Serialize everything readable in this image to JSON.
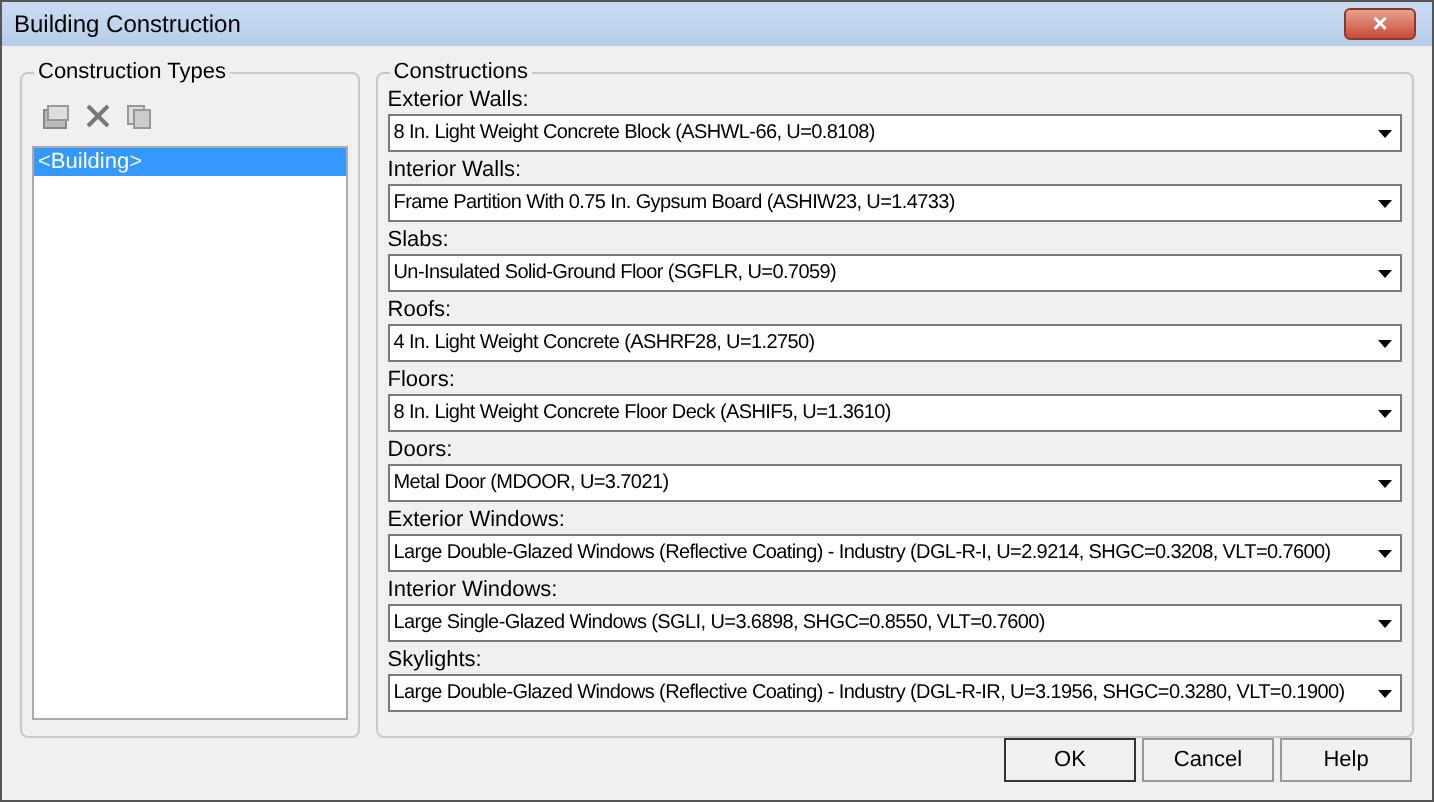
{
  "window": {
    "title": "Building Construction",
    "close": "×"
  },
  "construction_types": {
    "title": "Construction Types",
    "items": [
      {
        "label": "<Building>",
        "selected": true
      }
    ]
  },
  "constructions": {
    "title": "Constructions",
    "fields": [
      {
        "label": "Exterior Walls:",
        "value": "8 In. Light Weight Concrete Block (ASHWL-66, U=0.8108)"
      },
      {
        "label": "Interior Walls:",
        "value": "Frame Partition With 0.75 In. Gypsum Board (ASHIW23, U=1.4733)"
      },
      {
        "label": "Slabs:",
        "value": "Un-Insulated Solid-Ground Floor (SGFLR, U=0.7059)"
      },
      {
        "label": "Roofs:",
        "value": "4 In. Light Weight Concrete (ASHRF28, U=1.2750)"
      },
      {
        "label": "Floors:",
        "value": "8 In. Light Weight Concrete Floor Deck (ASHIF5, U=1.3610)"
      },
      {
        "label": "Doors:",
        "value": "Metal Door (MDOOR, U=3.7021)"
      },
      {
        "label": "Exterior Windows:",
        "value": "Large Double-Glazed Windows (Reflective Coating) - Industry (DGL-R-I, U=2.9214, SHGC=0.3208, VLT=0.7600)"
      },
      {
        "label": "Interior Windows:",
        "value": "Large Single-Glazed Windows (SGLI, U=3.6898, SHGC=0.8550, VLT=0.7600)"
      },
      {
        "label": "Skylights:",
        "value": "Large Double-Glazed Windows (Reflective Coating) - Industry (DGL-R-IR, U=3.1956, SHGC=0.3280, VLT=0.1900)"
      }
    ]
  },
  "buttons": [
    "OK",
    "Cancel",
    "Help"
  ]
}
